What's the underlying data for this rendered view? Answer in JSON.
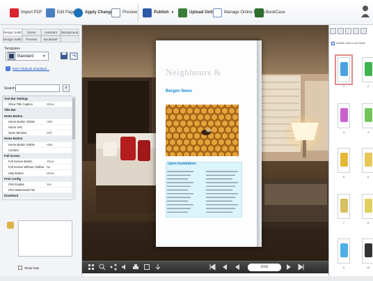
{
  "toolbar": {
    "buttons": [
      {
        "label": "Import PDF",
        "color": "#d9232f"
      },
      {
        "label": "Edit Pages",
        "color": "#4a7fc0"
      },
      {
        "label": "Apply Change",
        "color": "#1d6fb8"
      },
      {
        "label": "Preview",
        "color": "#7c8899"
      },
      {
        "label": "Publish",
        "color": "#2d5aa8"
      },
      {
        "label": "Upload Online",
        "color": "#3a7d3a"
      },
      {
        "label": "Manage Online Books",
        "color": "#6b8fc2"
      },
      {
        "label": "BookCase",
        "color": "#2d6e2d"
      }
    ]
  },
  "left_panel": {
    "tabs": [
      "Design Setting",
      "Scene",
      "Assistant",
      "Background",
      "Design Setting",
      "Preview",
      "Bookshelf",
      ""
    ],
    "templates_label": "Templates",
    "template_name": "Standard",
    "template_color": "#2b3f66",
    "more_templates_link": "More Flipbook templates...",
    "search_label": "Search",
    "search_value": "",
    "properties": [
      {
        "name": "Tool Bar Settings",
        "value": "",
        "group": true
      },
      {
        "name": "Show Title Caption",
        "value": "Show",
        "group": false
      },
      {
        "name": "Title Bar",
        "value": "",
        "group": true
      },
      {
        "name": "Home Button",
        "value": "",
        "group": true
      },
      {
        "name": "Home Button Visible",
        "value": "Hide",
        "group": false
      },
      {
        "name": "Home URL",
        "value": "",
        "group": false
      },
      {
        "name": "Open Window",
        "value": "Self",
        "group": false
      },
      {
        "name": "Home Button",
        "value": "",
        "group": true
      },
      {
        "name": "Home Button Visible",
        "value": "Hide",
        "group": false
      },
      {
        "name": "Content",
        "value": "",
        "group": false
      },
      {
        "name": "Full Screen",
        "value": "",
        "group": true
      },
      {
        "name": "Full Screen Button",
        "value": "Show",
        "group": false
      },
      {
        "name": "Full Screen Without Toolbar",
        "value": "No",
        "group": false
      },
      {
        "name": "Help Button",
        "value": "Show",
        "group": false
      },
      {
        "name": "Print Config",
        "value": "",
        "group": true
      },
      {
        "name": "Print Enable",
        "value": "Yes",
        "group": false
      },
      {
        "name": "Print Watermark File",
        "value": "",
        "group": false
      },
      {
        "name": "Download",
        "value": "",
        "group": true
      },
      {
        "name": "Download Enable",
        "value": "No",
        "group": false
      },
      {
        "name": "Download URL",
        "value": "",
        "group": false
      },
      {
        "name": "Sound",
        "value": "",
        "group": true
      },
      {
        "name": "Enable Sound",
        "value": "Enable",
        "group": false
      },
      {
        "name": "Sound File",
        "value": "",
        "group": false
      }
    ],
    "show_help_label": "Show help"
  },
  "book": {
    "title": "Neighbours &",
    "subtitle": "Bergen News",
    "box_title": "Upon Installation",
    "accent": "#1c8ad3"
  },
  "player": {
    "page_indicator": "2/16"
  },
  "right_panel": {
    "check_label": "Double click to set Home",
    "thumbnails": [
      {
        "num": "1",
        "color": "#4aa3e0"
      },
      {
        "num": "2",
        "color": "#3fb34f"
      },
      {
        "num": "3",
        "color": "#c860d0"
      },
      {
        "num": "4",
        "color": "#72c45a"
      },
      {
        "num": "5",
        "color": "#e6b838"
      },
      {
        "num": "6",
        "color": "#e6c858"
      },
      {
        "num": "7",
        "color": "#d6c060"
      },
      {
        "num": "8",
        "color": "#e0d060"
      },
      {
        "num": "9",
        "color": "#4cb0e6"
      },
      {
        "num": "10",
        "color": "#333333"
      }
    ]
  }
}
